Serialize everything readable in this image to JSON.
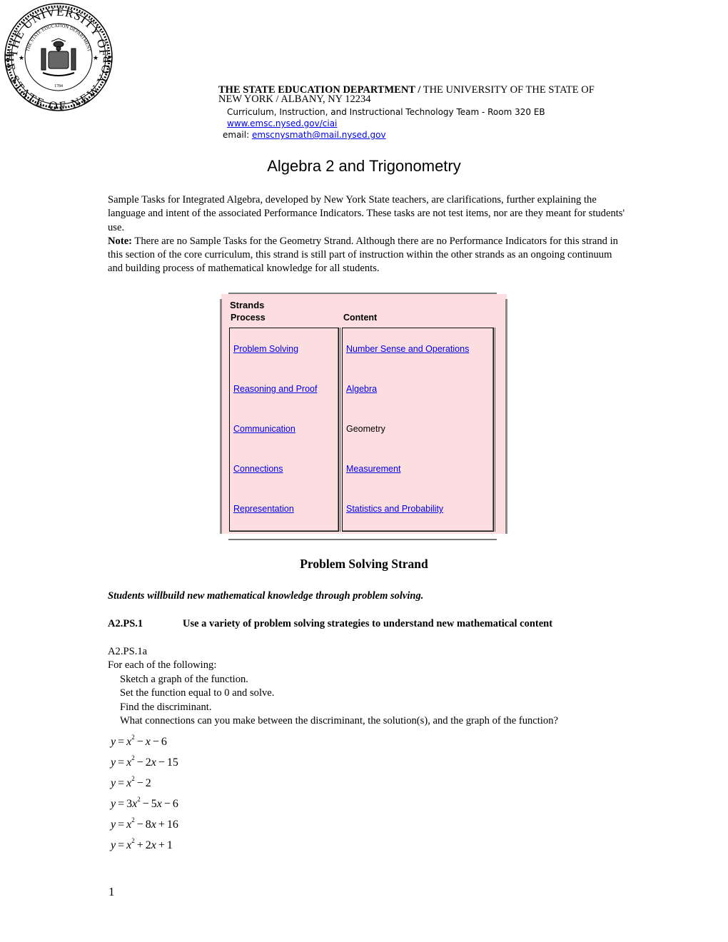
{
  "header": {
    "seal": {
      "outer_text_top": "THE UNIVERSITY OF",
      "outer_text_bottom": "THE STATE OF NEW YORK",
      "inner_text": "THE STATE EDUCATION DEPARTMENT",
      "year": "1784"
    },
    "dept_bold": "THE STATE EDUCATION DEPARTMENT /",
    "dept_rest": " THE UNIVERSITY OF THE STATE OF NEW YORK / ALBANY, NY 12234",
    "team": "Curriculum, Instruction, and Instructional Technology Team - Room 320 EB",
    "website": "www.emsc.nysed.gov/ciai",
    "email_label": "email: ",
    "email": "emscnysmath@mail.nysed.gov"
  },
  "title": "Algebra 2 and Trigonometry",
  "intro": {
    "paragraph": "Sample Tasks for Integrated Algebra, developed by New York State teachers, are clarifications, further explaining the language and intent of the associated Performance Indicators. These tasks are not test items, nor are they meant for students' use.",
    "note_label": "Note:",
    "note_text": " There are no Sample Tasks for the Geometry Strand. Although there are no Performance Indicators for this strand in this section of the core curriculum, this strand is still part of instruction within the other strands as an ongoing continuum and building process of mathematical knowledge for all students."
  },
  "strands": {
    "title": "Strands",
    "process_header": "Process",
    "content_header": "Content",
    "process": [
      {
        "label": "Problem Solving",
        "link": true
      },
      {
        "label": "Reasoning and Proof",
        "link": true
      },
      {
        "label": "Communication",
        "link": true
      },
      {
        "label": "Connections",
        "link": true
      },
      {
        "label": "Representation",
        "link": true
      }
    ],
    "content": [
      {
        "label": "Number Sense and Operations",
        "link": true
      },
      {
        "label": "Algebra",
        "link": true
      },
      {
        "label": "Geometry",
        "link": false
      },
      {
        "label": "Measurement",
        "link": true
      },
      {
        "label": "Statistics and Probability",
        "link": true
      }
    ],
    "colors": {
      "background": "#fcdde0",
      "link": "#0000ee"
    }
  },
  "section": {
    "heading": "Problem Solving Strand",
    "students_statement": "Students willbuild new mathematical knowledge through problem solving.",
    "pi_code": "A2.PS.1",
    "pi_text": "Use a variety of problem solving strategies to understand new mathematical content"
  },
  "task": {
    "code": "A2.PS.1a",
    "lead": "For each of the following:",
    "steps": [
      "Sketch a graph of the function.",
      "Set the function equal to 0 and solve.",
      "Find the discriminant.",
      "What connections can you make between the discriminant, the solution(s), and the graph of the function?"
    ],
    "equations": [
      {
        "lhs": "y",
        "coef": "",
        "rest": [
          [
            "−",
            "x"
          ],
          [
            "−",
            "6"
          ]
        ]
      },
      {
        "lhs": "y",
        "coef": "",
        "rest": [
          [
            "−",
            "2x"
          ],
          [
            "−",
            "15"
          ]
        ]
      },
      {
        "lhs": "y",
        "coef": "",
        "rest": [
          [
            "−",
            "2"
          ]
        ]
      },
      {
        "lhs": "y",
        "coef": "3",
        "rest": [
          [
            "−",
            "5x"
          ],
          [
            "−",
            "6"
          ]
        ]
      },
      {
        "lhs": "y",
        "coef": "",
        "rest": [
          [
            "−",
            "8x"
          ],
          [
            "+",
            "16"
          ]
        ]
      },
      {
        "lhs": "y",
        "coef": "",
        "rest": [
          [
            "+",
            "2x"
          ],
          [
            "+",
            "1"
          ]
        ]
      }
    ],
    "equations_text": [
      "y = x^2 − x − 6",
      "y = x^2 − 2x − 15",
      "y = x^2 − 2",
      "y = 3x^2 − 5x − 6",
      "y = x^2 − 8x + 16",
      "y = x^2 + 2x + 1"
    ]
  },
  "footer": {
    "page_number": "1"
  }
}
